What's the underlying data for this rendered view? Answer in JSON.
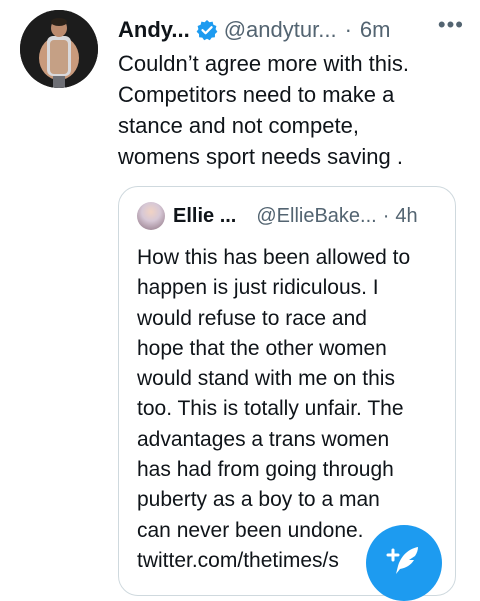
{
  "tweet": {
    "author_name": "Andy...",
    "handle": "@andytur...",
    "separator": "·",
    "time": "6m",
    "more_label": "•••",
    "text_lines": [
      "Couldn’t agree more with this.",
      "Competitors need to make a",
      "stance and not compete,",
      "womens sport needs saving ."
    ]
  },
  "quote": {
    "author_name": "Ellie ...",
    "handle": "@EllieBake...",
    "separator": "·",
    "time": "4h",
    "text_lines": [
      "How this has been allowed to",
      "happen is just ridiculous. I",
      "would refuse to race and",
      "hope that the other women",
      "would stand with me on this",
      "too. This is totally unfair. The",
      "advantages a trans women",
      "has had from going through",
      "puberty as a boy to a man",
      "can never been undone.",
      "twitter.com/thetimes/s"
    ]
  },
  "icons": {
    "verified": "verified-badge-icon",
    "compose": "compose-tweet-icon"
  },
  "colors": {
    "accent": "#1d9bf0",
    "secondary_text": "#536471",
    "border": "#cfd9de"
  }
}
